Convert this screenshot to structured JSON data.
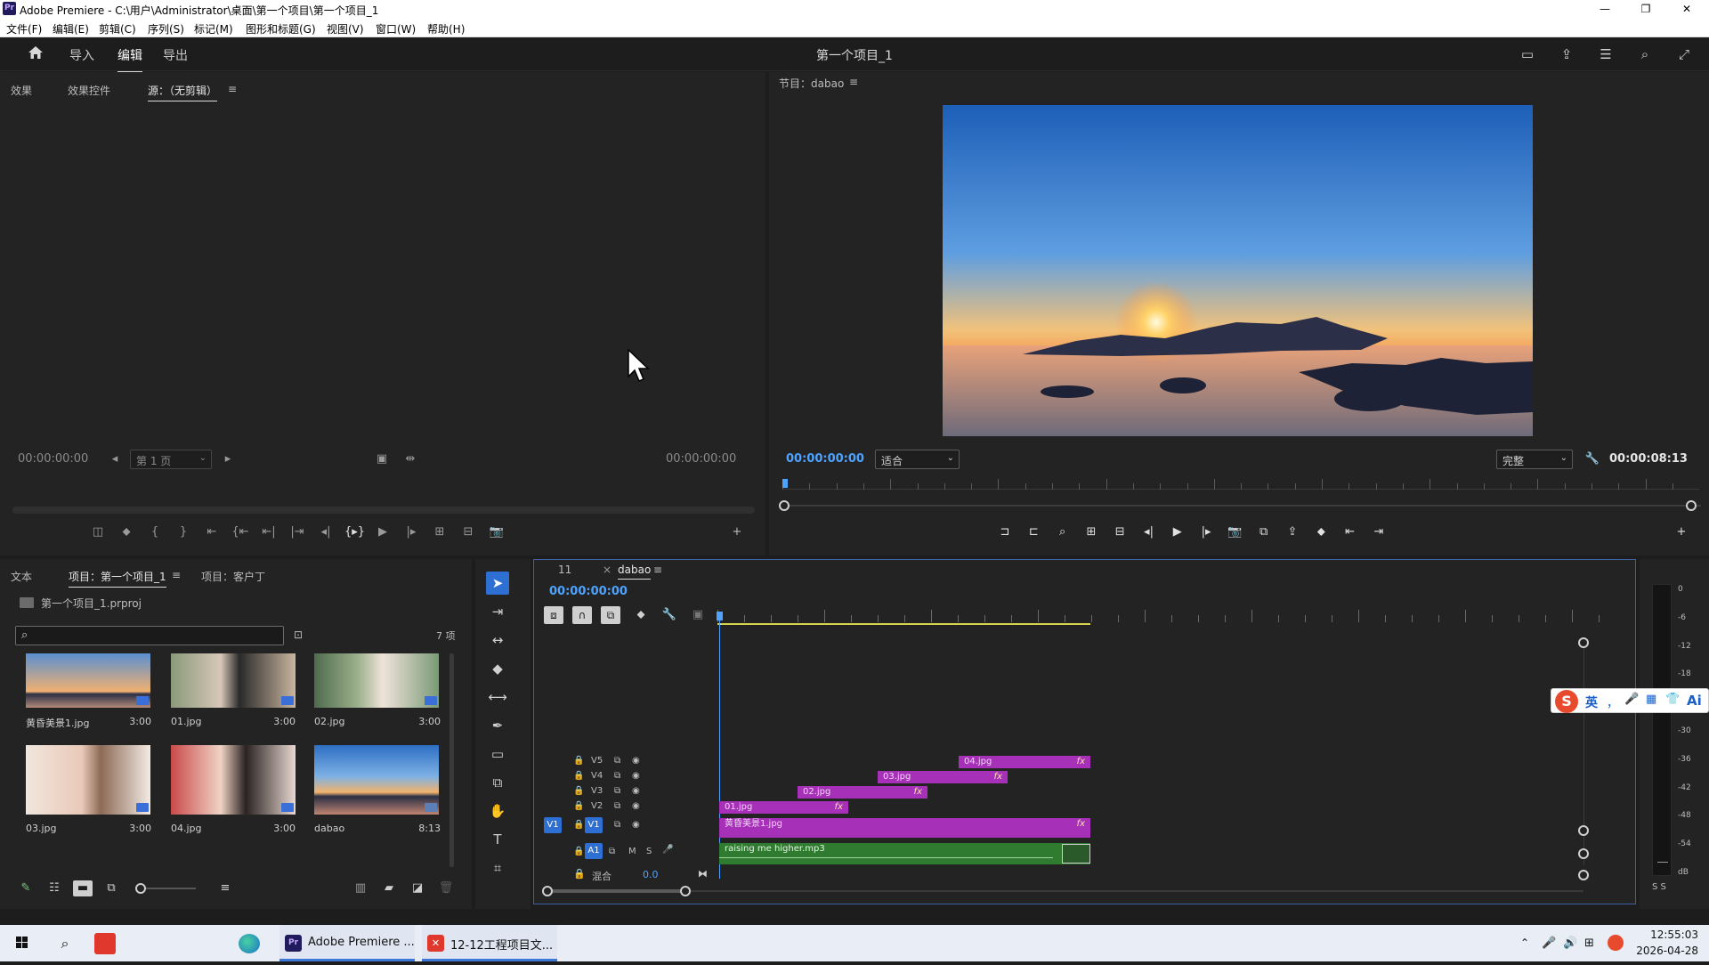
{
  "window": {
    "app_logo": "Pr",
    "title": "Adobe Premiere - C:\\用户\\Administrator\\桌面\\第一个项目\\第一个项目_1",
    "controls": [
      "—",
      "❐",
      "✕"
    ]
  },
  "menu": [
    "文件(F)",
    "编辑(E)",
    "剪辑(C)",
    "序列(S)",
    "标记(M)",
    "图形和标题(G)",
    "视图(V)",
    "窗口(W)",
    "帮助(H)"
  ],
  "header": {
    "home_icon": "home-icon",
    "tabs": [
      "导入",
      "编辑",
      "导出"
    ],
    "active_tab": "编辑",
    "project_title": "第一个项目_1"
  },
  "source_panel": {
    "tabs": [
      "效果",
      "效果控件",
      "源：（无剪辑）"
    ],
    "tab_menu": "≡",
    "timecode_left": "00:00:00:00",
    "timecode_right": "00:00:00:00",
    "page_select": "第 1 页",
    "transport": [
      "◫",
      "⬥",
      "{",
      "}",
      "⇤",
      "{⇤",
      "⇤|",
      "|⇥",
      "◂|",
      "{▸}",
      "▶",
      "|▸",
      "⊞",
      "⊟",
      "📷"
    ]
  },
  "program_panel": {
    "tab": "节目：dabao",
    "tab_menu": "≡",
    "timecode": "00:00:00:00",
    "fit_select": "适合",
    "quality_select": "完整",
    "duration": "00:00:08:13",
    "colors": {
      "timecode": "#4da3ff"
    }
  },
  "project_panel": {
    "tabs": [
      "文本",
      "项目：第一个项目_1",
      "项目：客户丁"
    ],
    "tab_menu": "≡",
    "project_file": "第一个项目_1.prproj",
    "search_placeholder": "",
    "item_count": "7 项",
    "items": [
      {
        "name": "黄昏美景1.jpg",
        "duration": "3:00"
      },
      {
        "name": "01.jpg",
        "duration": "3:00"
      },
      {
        "name": "02.jpg",
        "duration": "3:00"
      },
      {
        "name": "03.jpg",
        "duration": "3:00"
      },
      {
        "name": "04.jpg",
        "duration": "3:00"
      },
      {
        "name": "dabao",
        "duration": "8:13"
      }
    ]
  },
  "timeline": {
    "tabs": [
      "11",
      "dabao"
    ],
    "close_mark": "×",
    "tab_menu": "≡",
    "timecode": "00:00:00:00",
    "tracks": [
      {
        "id": "V5",
        "clips": [
          {
            "name": "04.jpg",
            "fx": "fx"
          }
        ]
      },
      {
        "id": "V4",
        "clips": [
          {
            "name": "03.jpg",
            "fx": "fx"
          }
        ]
      },
      {
        "id": "V3",
        "clips": [
          {
            "name": "02.jpg",
            "fx": "fx"
          }
        ]
      },
      {
        "id": "V2",
        "clips": [
          {
            "name": "01.jpg",
            "fx": "fx"
          }
        ]
      },
      {
        "id": "V1",
        "src": "V1",
        "clips": [
          {
            "name": "黄昏美景1.jpg",
            "fx": "fx"
          }
        ]
      }
    ],
    "audio": {
      "src": "A1",
      "id": "A1",
      "m": "M",
      "s": "S",
      "clip": "raising me higher.mp3"
    },
    "mix": {
      "label": "混合",
      "value": "0.0"
    }
  },
  "vu_meter": {
    "labels": [
      "0",
      "-6",
      "-12",
      "-18",
      "-24",
      "-30",
      "-36",
      "-42",
      "-48",
      "-54",
      "dB"
    ],
    "footer": "S  S"
  },
  "ime_toolbar": {
    "logo": "S",
    "lang": "英",
    "items": [
      "，",
      "🎤",
      "▦",
      "👕",
      "Ai"
    ]
  },
  "taskbar": {
    "apps": [
      {
        "label": "Adobe Premiere ..."
      },
      {
        "label": "12-12工程项目文..."
      }
    ],
    "time": "12:55:03",
    "date": "2026-04-28"
  }
}
